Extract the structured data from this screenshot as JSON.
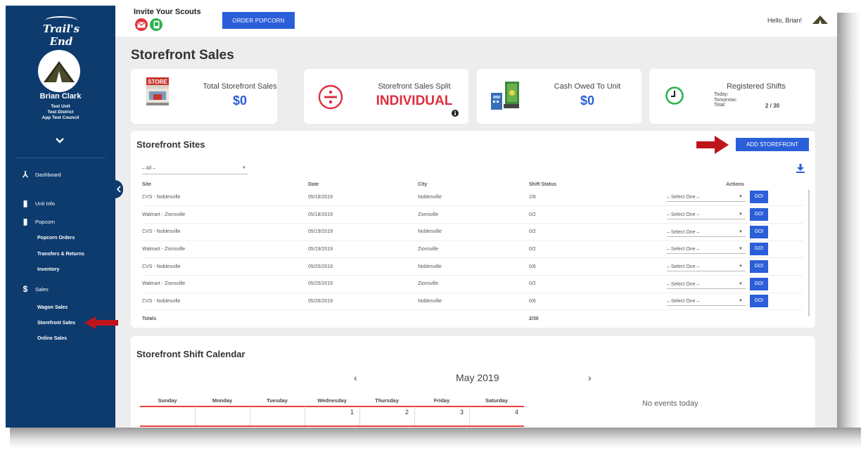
{
  "brand": {
    "logo_text": "Trail's End"
  },
  "user": {
    "name": "Brian Clark",
    "unit": "Test Unit",
    "district": "Test District",
    "council": "App Test Council"
  },
  "sidebar": {
    "items": [
      {
        "label": "Dashboard"
      },
      {
        "label": "Unit Info"
      },
      {
        "label": "Popcorn"
      },
      {
        "label": "Popcorn Orders"
      },
      {
        "label": "Transfers & Returns"
      },
      {
        "label": "Inventory"
      },
      {
        "label": "Sales"
      },
      {
        "label": "Wagon Sales"
      },
      {
        "label": "Storefront Sales"
      },
      {
        "label": "Online Sales"
      }
    ],
    "active": "Storefront Sales"
  },
  "topbar": {
    "invite_title": "Invite Your Scouts",
    "order_button": "ORDER POPCORN",
    "greeting": "Hello, Brian!"
  },
  "page": {
    "title": "Storefront Sales"
  },
  "stats": {
    "total_label": "Total Storefront Sales",
    "total_value": "$0",
    "split_label": "Storefront Sales Split",
    "split_value": "INDIVIDUAL",
    "cash_label": "Cash Owed To Unit",
    "cash_value": "$0",
    "shifts_label": "Registered Shifts",
    "today_label": "Today:",
    "tomorrow_label": "Tomorrow:",
    "total_shifts_label": "Total:",
    "total_shifts_value": "2 / 30",
    "store_sign": "STORE"
  },
  "sites": {
    "title": "Storefront Sites",
    "add_button": "ADD STOREFRONT",
    "filter_value": "– All –",
    "columns": {
      "site": "Site",
      "date": "Date",
      "city": "City",
      "status": "Shift Status",
      "actions": "Actions"
    },
    "rows": [
      {
        "site": "CVS - Noblesville",
        "date": "05/18/2019",
        "city": "Noblesville",
        "status": "2/8"
      },
      {
        "site": "Walmart - Zionsville",
        "date": "05/18/2019",
        "city": "Zionsville",
        "status": "0/2"
      },
      {
        "site": "CVS - Noblesville",
        "date": "05/19/2019",
        "city": "Noblesville",
        "status": "0/2"
      },
      {
        "site": "Walmart - Zionsville",
        "date": "05/19/2019",
        "city": "Zionsville",
        "status": "0/2"
      },
      {
        "site": "CVS - Noblesville",
        "date": "05/25/2019",
        "city": "Noblesville",
        "status": "0/6"
      },
      {
        "site": "Walmart - Zionsville",
        "date": "05/25/2019",
        "city": "Zionsville",
        "status": "0/2"
      },
      {
        "site": "CVS - Noblesville",
        "date": "05/26/2019",
        "city": "Noblesville",
        "status": "0/6"
      }
    ],
    "select_placeholder": "– Select One –",
    "go_label": "GO!",
    "totals_label": "Totals",
    "totals_value": "2/30"
  },
  "calendar": {
    "title": "Storefront Shift Calendar",
    "month": "May 2019",
    "prev": "‹",
    "next": "›",
    "days": [
      "Sunday",
      "Monday",
      "Tuesday",
      "Wednesday",
      "Thursday",
      "Friday",
      "Saturday"
    ],
    "first_week": [
      "",
      "",
      "",
      "1",
      "2",
      "3",
      "4"
    ],
    "no_events": "No events today"
  },
  "colors": {
    "sidebar": "#0d3b6e",
    "primary": "#2b5fd9",
    "accent_red": "#e02d3c",
    "arrow": "#c0141b"
  }
}
